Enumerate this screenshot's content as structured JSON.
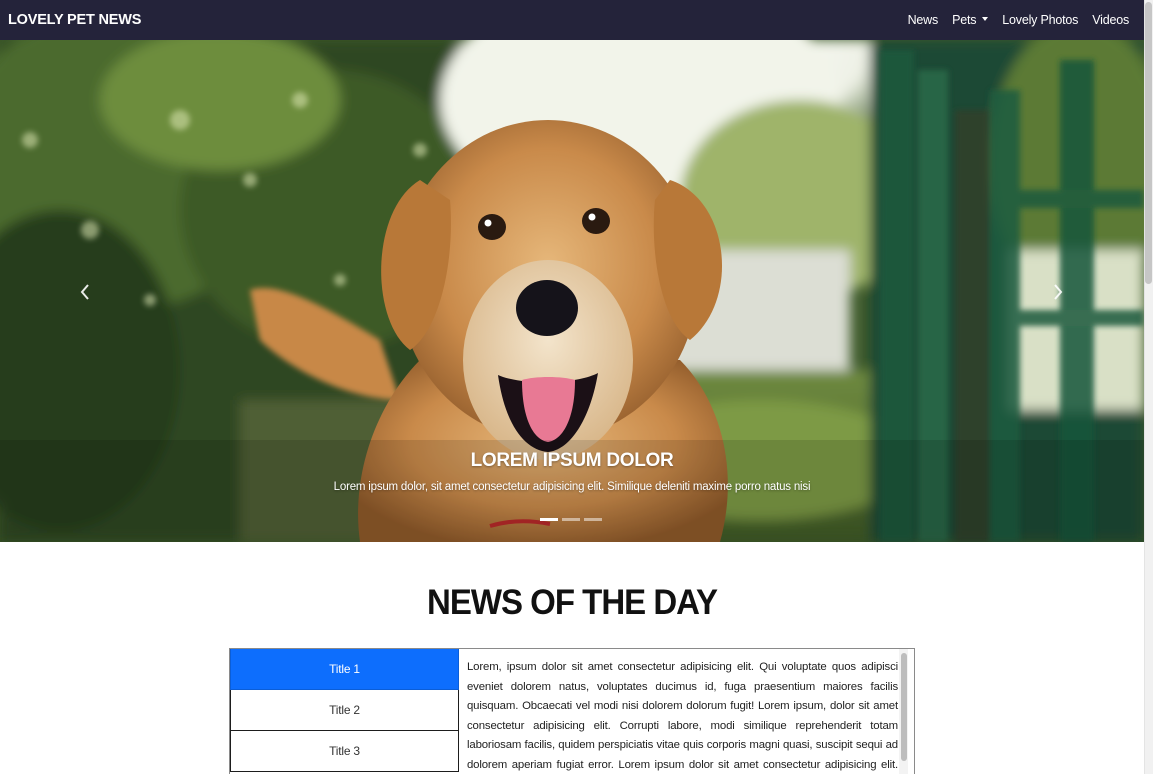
{
  "navbar": {
    "brand": "LOVELY PET NEWS",
    "links": [
      {
        "label": "News"
      },
      {
        "label": "Pets",
        "dropdown": true
      },
      {
        "label": "Lovely Photos"
      },
      {
        "label": "Videos"
      }
    ]
  },
  "carousel": {
    "caption_title": "LOREM IPSUM DOLOR",
    "caption_text": "Lorem ipsum dolor, sit amet consectetur adipisicing elit. Similique deleniti maxime porro natus nisi",
    "indicators": 3,
    "active_index": 0,
    "prev_icon": "chevron-left-icon",
    "next_icon": "chevron-right-icon"
  },
  "news": {
    "heading": "NEWS OF THE DAY",
    "tabs": [
      {
        "label": "Title 1"
      },
      {
        "label": "Title 2"
      },
      {
        "label": "Title 3"
      }
    ],
    "active_tab": 0,
    "panel_text": "Lorem, ipsum dolor sit amet consectetur adipisicing elit. Qui voluptate quos adipisci eveniet dolorem natus, voluptates ducimus id, fuga praesentium maiores facilis quisquam. Obcaecati vel modi nisi dolorem dolorum fugit! Lorem ipsum, dolor sit amet consectetur adipisicing elit. Corrupti labore, modi similique reprehenderit totam laboriosam facilis, quidem perspiciatis vitae quis corporis magni quasi, suscipit sequi ad dolorem aperiam fugiat error. Lorem ipsum dolor sit amet consectetur adipisicing elit. Sunt quidem sit assumenda inventore possimus fugiat, cupiditate"
  },
  "colors": {
    "navbar_bg": "#24233a",
    "tab_active": "#0d6efd"
  }
}
